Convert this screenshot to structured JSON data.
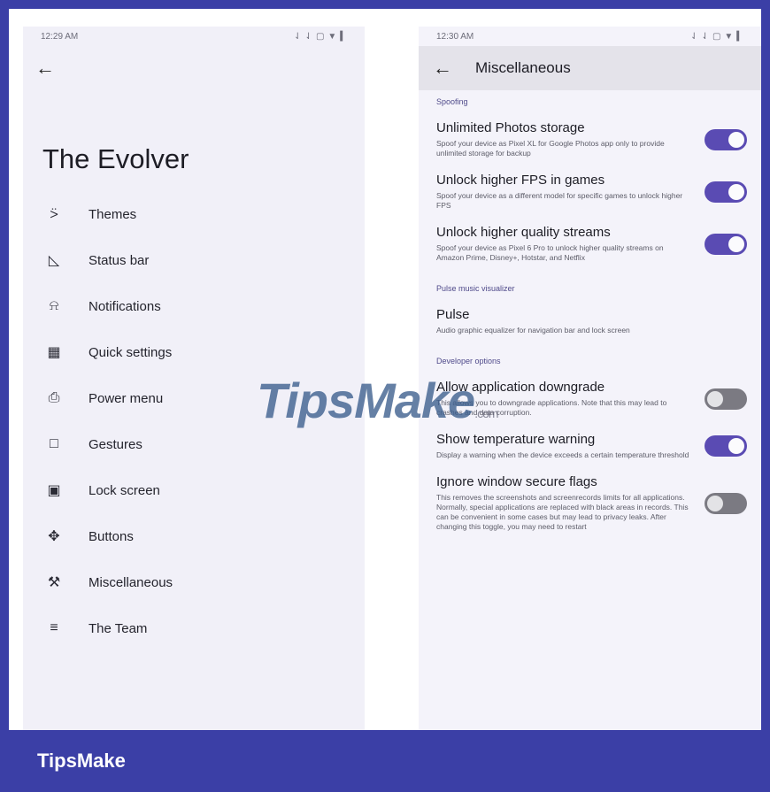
{
  "colors": {
    "accent": "#5a4bb3",
    "frame": "#3b3fa6",
    "toggle_off": "#7b7a82"
  },
  "left_screen": {
    "status": {
      "time": "12:29 AM",
      "icons": [
        "network-icon",
        "network-icon",
        "battery-saver-icon",
        "wifi-icon",
        "battery-icon"
      ]
    },
    "title": "The Evolver",
    "menu": [
      {
        "icon": "paint-roller-icon",
        "glyph": "⍩",
        "label": "Themes"
      },
      {
        "icon": "signal-icon",
        "glyph": "◺",
        "label": "Status bar"
      },
      {
        "icon": "bell-icon",
        "glyph": "ὑ4",
        "label": "Notifications"
      },
      {
        "icon": "grid-icon",
        "glyph": "▦",
        "label": "Quick settings"
      },
      {
        "icon": "power-icon",
        "glyph": "⎙",
        "label": "Power menu"
      },
      {
        "icon": "gesture-icon",
        "glyph": "□",
        "label": "Gestures"
      },
      {
        "icon": "lock-screen-icon",
        "glyph": "▣",
        "label": "Lock screen"
      },
      {
        "icon": "buttons-icon",
        "glyph": "✥",
        "label": "Buttons"
      },
      {
        "icon": "wrench-icon",
        "glyph": "⚒",
        "label": "Miscellaneous"
      },
      {
        "icon": "team-icon",
        "glyph": "≡",
        "label": "The Team"
      }
    ]
  },
  "right_screen": {
    "status": {
      "time": "12:30 AM"
    },
    "title": "Miscellaneous",
    "sections": {
      "spoofing": "Spoofing",
      "pulse": "Pulse music visualizer",
      "developer": "Developer options"
    },
    "settings": {
      "photos": {
        "title": "Unlimited Photos storage",
        "desc": "Spoof your device as Pixel XL for Google Photos app only to provide unlimited storage for backup",
        "on": true
      },
      "fps": {
        "title": "Unlock higher FPS in games",
        "desc": "Spoof your device as a different model for specific games to unlock higher FPS",
        "on": true
      },
      "streams": {
        "title": "Unlock higher quality streams",
        "desc": "Spoof your device as Pixel 6 Pro to unlock higher quality streams on Amazon Prime, Disney+, Hotstar, and Netflix",
        "on": true
      },
      "pulse": {
        "title": "Pulse",
        "desc": "Audio graphic equalizer for navigation bar and lock screen"
      },
      "downgrade": {
        "title": "Allow application downgrade",
        "desc": "This allows you to downgrade applications. Note that this may lead to crashes and data corruption.",
        "on": false
      },
      "temperature": {
        "title": "Show temperature warning",
        "desc": "Display a warning when the device exceeds a certain temperature threshold",
        "on": true
      },
      "secure": {
        "title": "Ignore window secure flags",
        "desc": "This removes the screenshots and screenrecords limits for all applications. Normally, special applications are replaced with black areas in records. This can be convenient in some cases but may lead to privacy leaks. After changing this toggle, you may need to restart",
        "on": false
      }
    }
  },
  "watermark": {
    "text": "TipsMake",
    "suffix": ".com"
  },
  "brand": "TipsMake"
}
